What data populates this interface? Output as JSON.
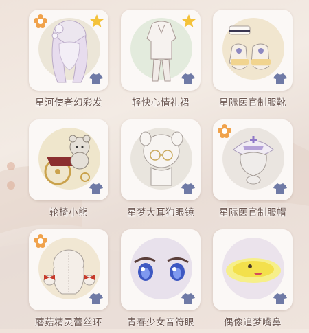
{
  "items": [
    {
      "name": "星河使者幻彩发",
      "disc": "#ece6d8",
      "flower": true,
      "star": true,
      "icon": "long-hair-icon"
    },
    {
      "name": "轻快心情礼裙",
      "disc": "#e3ebdd",
      "flower": false,
      "star": true,
      "icon": "dress-icon"
    },
    {
      "name": "星际医官制服靴",
      "disc": "#f1e6cf",
      "flower": false,
      "star": false,
      "icon": "boots-icon"
    },
    {
      "name": "轮椅小熊",
      "disc": "#efe6cc",
      "flower": false,
      "star": false,
      "icon": "wheelchair-bear-icon"
    },
    {
      "name": "星梦大耳狗眼镜",
      "disc": "#e9e5de",
      "flower": false,
      "star": false,
      "icon": "glasses-icon"
    },
    {
      "name": "星际医官制服帽",
      "disc": "#eae5e0",
      "flower": true,
      "star": false,
      "icon": "nurse-hat-icon"
    },
    {
      "name": "蘑菇精灵蕾丝环",
      "disc": "#f1e7d3",
      "flower": true,
      "star": false,
      "icon": "bunny-doll-icon"
    },
    {
      "name": "青春少女音符眼",
      "disc": "#e8e1ec",
      "flower": false,
      "star": false,
      "icon": "anime-eyes-icon"
    },
    {
      "name": "偶像追梦嘴鼻",
      "disc": "#ebe3ec",
      "flower": false,
      "star": false,
      "icon": "nose-mouth-icon"
    }
  ],
  "colors": {
    "flower": "#f0a24b",
    "star": "#f4c23a",
    "shirt": "#6f7aa6"
  }
}
